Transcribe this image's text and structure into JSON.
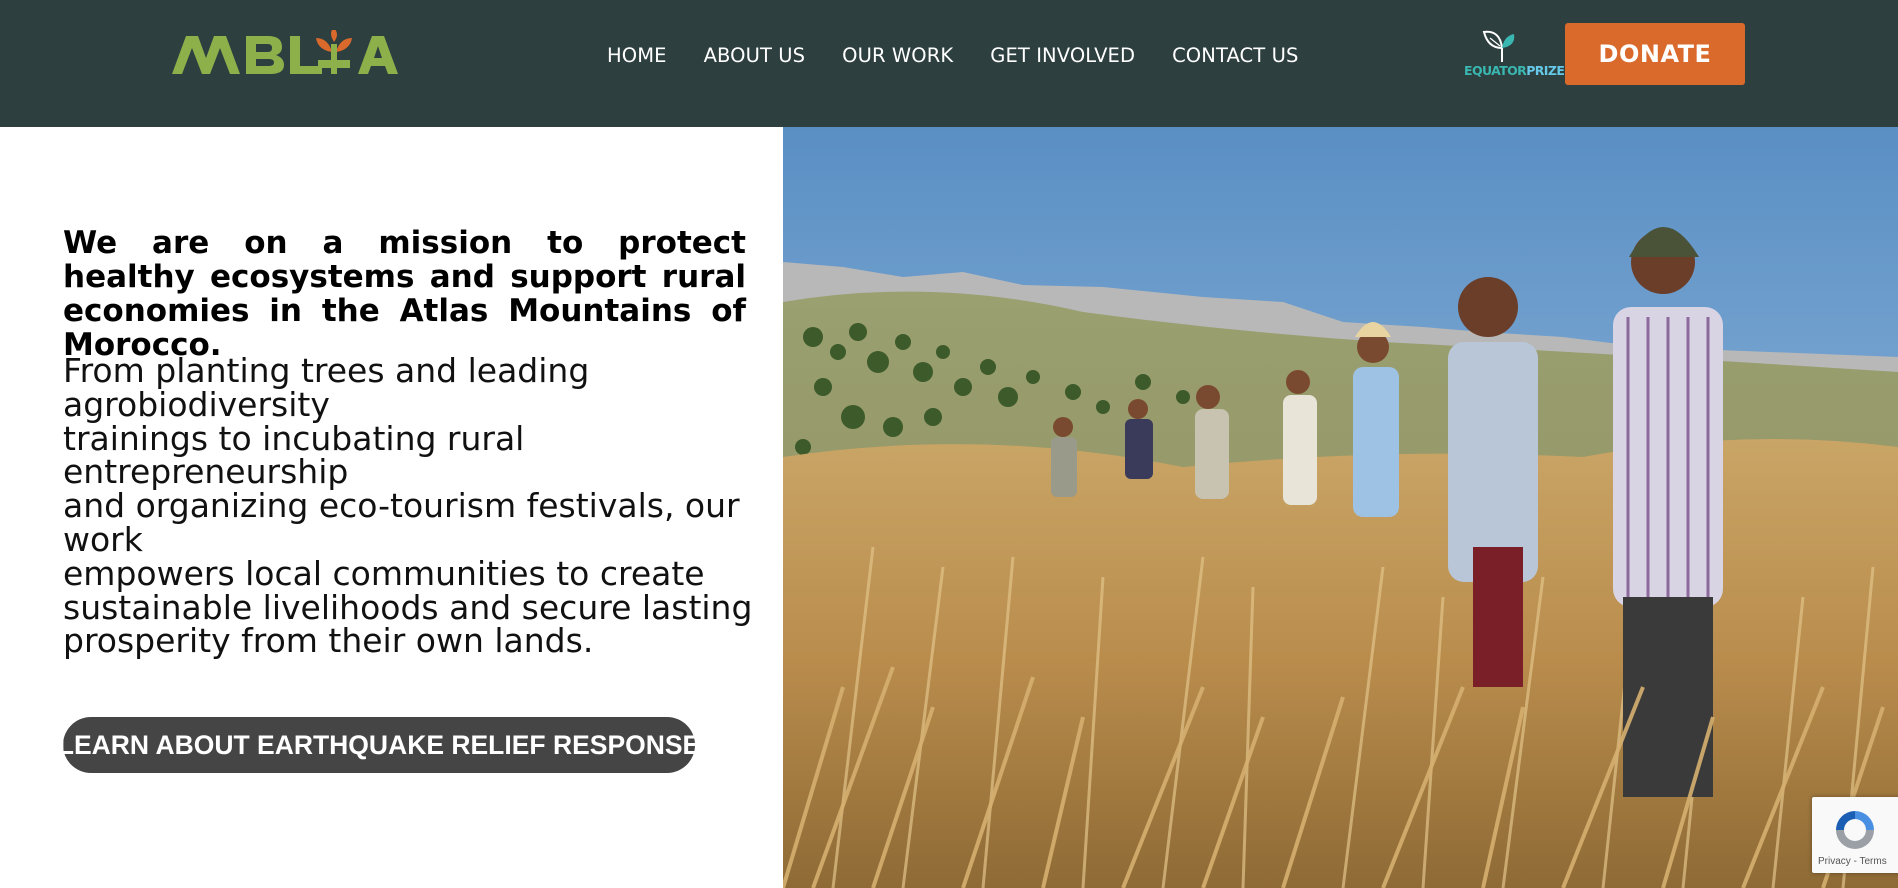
{
  "header": {
    "logo_text": "MBLA",
    "nav": [
      "HOME",
      "ABOUT US",
      "OUR WORK",
      "GET INVOLVED",
      "CONTACT US"
    ],
    "equator_prize": {
      "part1": "EQUATOR",
      "part2": "PRIZE"
    },
    "donate_label": "DONATE"
  },
  "hero": {
    "heading": "We are on a mission to protect healthy ecosystems and support rural economies in the Atlas Mountains of Morocco.",
    "body_lines": [
      "From planting trees and leading",
      "agrobiodiversity",
      "trainings to incubating rural",
      "entrepreneurship",
      "and organizing eco-tourism festivals, our",
      "work",
      "empowers local communities to create",
      "sustainable livelihoods and secure lasting",
      "prosperity from their own lands."
    ],
    "cta_label": "LEARN ABOUT EARTHQUAKE RELIEF RESPONSE"
  },
  "recaptcha": {
    "links": "Privacy - Terms"
  },
  "colors": {
    "header_bg": "#2e3f3f",
    "logo_green": "#8db04b",
    "donate_orange": "#d96a2c",
    "cta_bg": "#454545"
  },
  "icons": [
    "leaf-logo-icon",
    "equator-leaf-icon",
    "recaptcha-icon"
  ]
}
